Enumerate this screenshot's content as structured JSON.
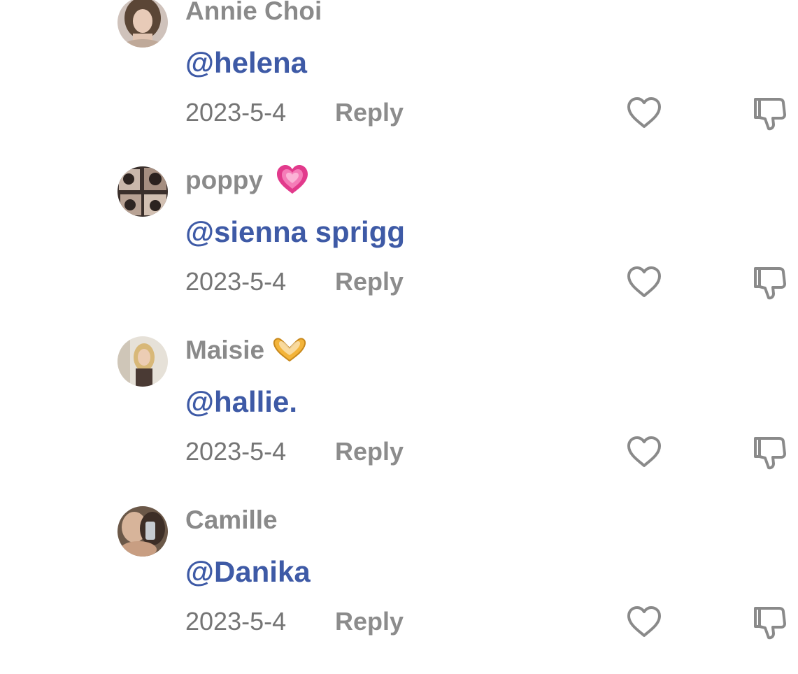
{
  "comments": [
    {
      "username": "Annie Choi",
      "emoji": "",
      "mention": "@helena",
      "date": "2023-5-4",
      "reply_label": "Reply",
      "avatar": "avatar-woman-dark-hair"
    },
    {
      "username": "poppy",
      "emoji": "pink-heart-emoji",
      "mention": "@sienna sprigg",
      "date": "2023-5-4",
      "reply_label": "Reply",
      "avatar": "avatar-photo-collage"
    },
    {
      "username": "Maisie",
      "emoji": "heart-hands-emoji",
      "mention": "@hallie.",
      "date": "2023-5-4",
      "reply_label": "Reply",
      "avatar": "avatar-mirror-selfie"
    },
    {
      "username": "Camille",
      "emoji": "",
      "mention": "@Danika",
      "date": "2023-5-4",
      "reply_label": "Reply",
      "avatar": "avatar-couple-selfie"
    }
  ],
  "icons": {
    "like": "heart-outline-icon",
    "dislike": "thumbs-down-outline-icon"
  },
  "colors": {
    "username": "#8a8a8a",
    "mention": "#3e5aa6",
    "date": "#757575",
    "reply": "#8c8c8c",
    "icon": "#8a8a8a"
  }
}
